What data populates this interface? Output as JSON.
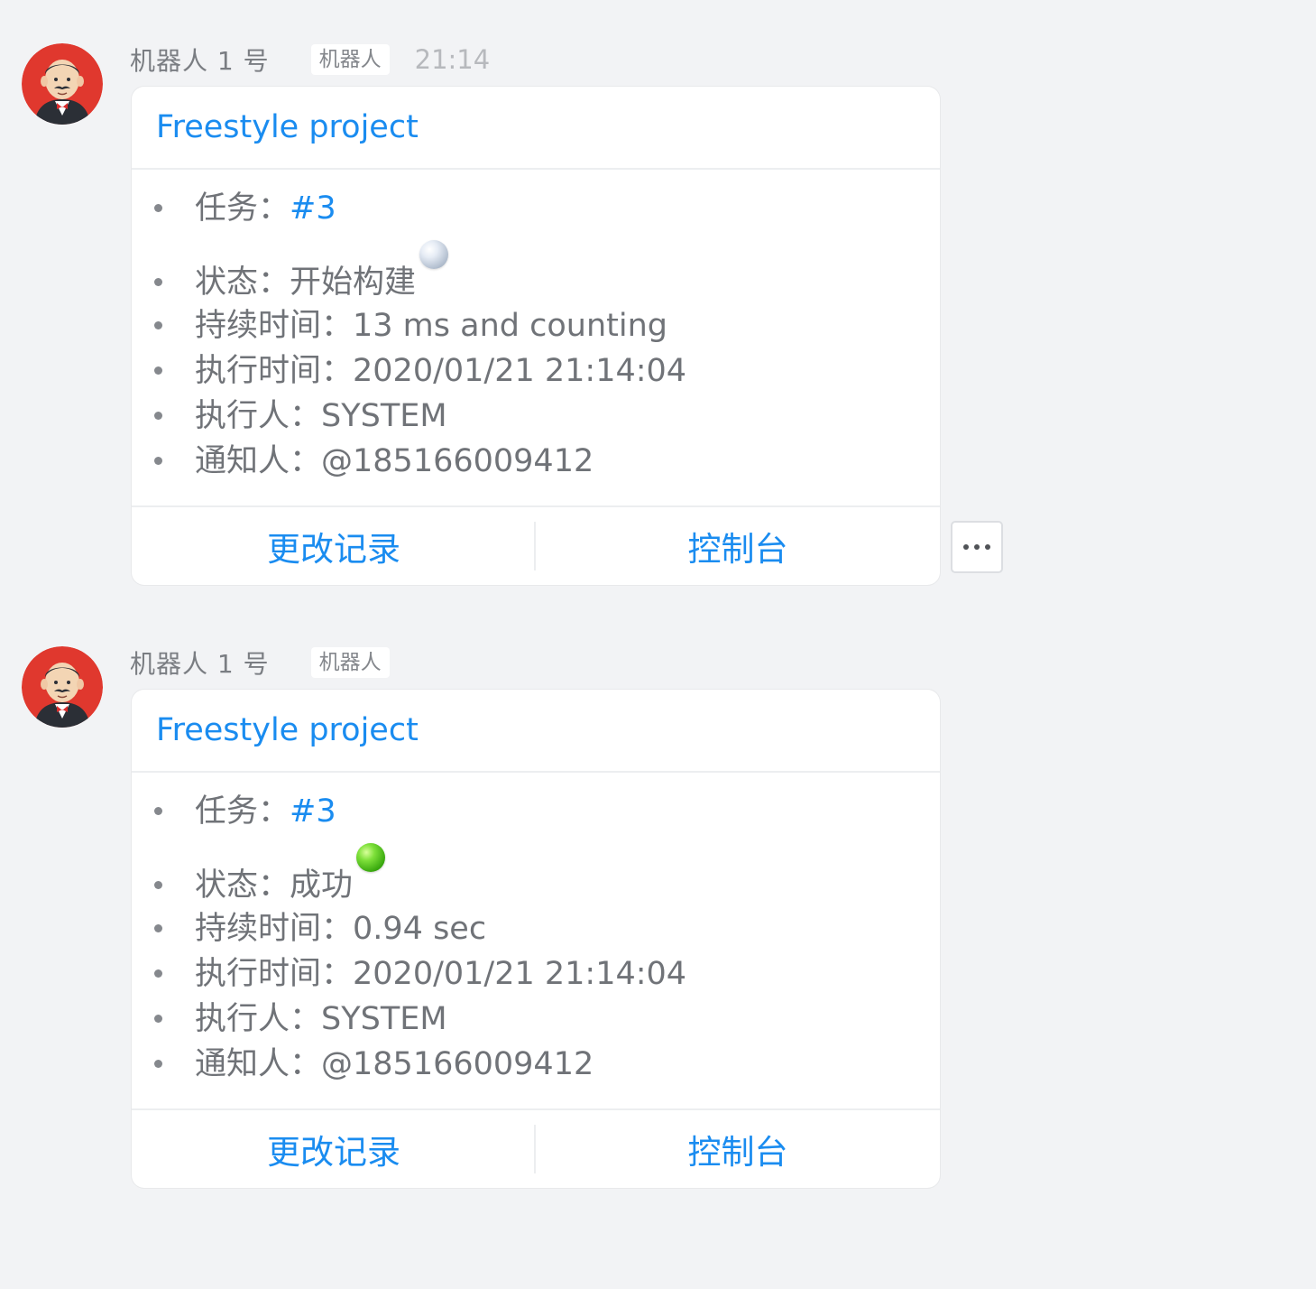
{
  "messages": [
    {
      "sender": "机器人 1 号",
      "tag": "机器人",
      "time": "21:14",
      "card": {
        "title": "Freestyle project",
        "rows": [
          {
            "label": "任务：",
            "value": "#3"
          },
          {
            "label": "状态：",
            "value": "开始构建",
            "status_icon": "grey-ball-icon"
          },
          {
            "label": "持续时间：",
            "value": "13 ms and counting"
          },
          {
            "label": "执行时间：",
            "value": "2020/01/21 21:14:04"
          },
          {
            "label": "执行人：",
            "value": "SYSTEM"
          },
          {
            "label": "通知人：",
            "value": "@185166009412"
          }
        ],
        "actions": [
          "更改记录",
          "控制台"
        ]
      },
      "more_button": "more-options-icon"
    },
    {
      "sender": "机器人 1 号",
      "tag": "机器人",
      "card": {
        "title": "Freestyle project",
        "rows": [
          {
            "label": "任务：",
            "value": "#3"
          },
          {
            "label": "状态：",
            "value": "成功",
            "status_icon": "green-ball-icon"
          },
          {
            "label": "持续时间：",
            "value": "0.94 sec"
          },
          {
            "label": "执行时间：",
            "value": "2020/01/21 21:14:04"
          },
          {
            "label": "执行人：",
            "value": "SYSTEM"
          },
          {
            "label": "通知人：",
            "value": "@185166009412"
          }
        ],
        "actions": [
          "更改记录",
          "控制台"
        ]
      }
    }
  ],
  "colors": {
    "background": "#f2f3f5",
    "link": "#1a8cf0",
    "text": "#707378",
    "avatar_bg": "#e0382e"
  }
}
